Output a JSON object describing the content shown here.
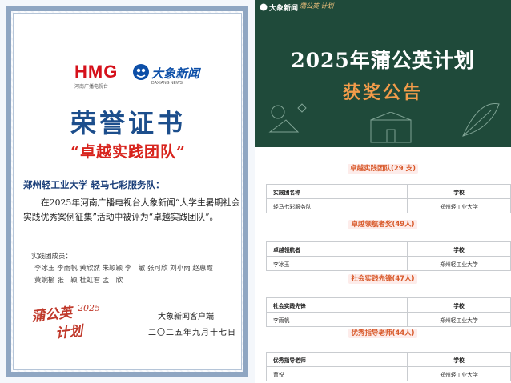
{
  "certificate": {
    "hmg_logo": "HMG",
    "hmg_subtitle": "河南广播电视台",
    "daxiang_logo": "大象新闻",
    "daxiang_subtitle": "DAXIANG NEWS",
    "title": "荣誉证书",
    "award": "“卓越实践团队”",
    "team": "郑州轻工业大学 轻马七彩服务队：",
    "body": "在2025年河南广播电视台大象新闻“大学生暑期社会实践优秀案例征集”活动中被评为“卓越实践团队”。",
    "members_label": "实践团成员：",
    "members_line1": "李冰玉 李雨帆 黄欣然 朱颖颖 李　敏 张可欣 刘小雨 赵惠霞",
    "members_line2": "黄婉榆 张　颖 杜虹君 孟　欣",
    "seal_text1": "蒲公英",
    "seal_year": "2025",
    "seal_text2": "计划",
    "issuer": "大象新闻客户端",
    "date": "二〇二五年九月十七日"
  },
  "announcement": {
    "logo": "大象新闻",
    "mini_mark": "蒲公英 计划",
    "title": "2025年蒲公英计划",
    "subtitle": "获奖公告",
    "sections": [
      {
        "heading": "卓越实践团队(29 支)",
        "col1": "实践团名称",
        "col2": "学校",
        "name": "轻马七彩服务队",
        "school": "郑州轻工业大学"
      },
      {
        "heading": "卓越领航者奖(49人)",
        "col1": "卓越领航者",
        "col2": "学校",
        "name": "李冰玉",
        "school": "郑州轻工业大学"
      },
      {
        "heading": "社会实践先锋(47人)",
        "col1": "社会实践先锋",
        "col2": "学校",
        "name": "李雨帆",
        "school": "郑州轻工业大学"
      },
      {
        "heading": "优秀指导老师(44人)",
        "col1": "优秀指导老师",
        "col2": "学校",
        "name": "曹悦",
        "school": "郑州轻工业大学"
      }
    ]
  },
  "colors": {
    "title_blue": "#1c4e8c",
    "award_red": "#d8231c",
    "board_green": "#1f4a3a",
    "accent_orange": "#f39c4a"
  }
}
